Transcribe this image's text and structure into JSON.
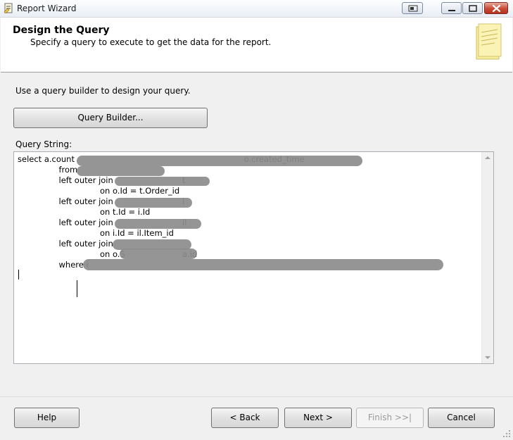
{
  "window": {
    "title": "Report Wizard",
    "icon": "report-wizard-icon"
  },
  "header": {
    "title": "Design the Query",
    "subtitle": "Specify a query to execute to get the data for the report.",
    "icon": "notepad-icon"
  },
  "body": {
    "instruction": "Use a query builder to design your query.",
    "query_builder_label": "Query Builder...",
    "query_string_label": "Query String:",
    "query_text": "select a.count\t\t\t\t\t\t\t\t\to.created_time\n\t\tfrom\n\t\tleft outer join\t\t\t\tt\n\t\t\t\ton o.Id = t.Order_id\n\t\tleft outer join\t\t\t\ti\n\t\t\t\ton t.Id = i.Id\n\t\tleft outer join\t\t\t\til\n\t\t\t\ton i.Id = il.Item_id\n\t\tleft outer join\n\t\t\t\ton o.S\t\t\ta.id\n\t\twhere i"
  },
  "footer": {
    "help_label": "Help",
    "back_label": "< Back",
    "next_label": "Next >",
    "finish_label": "Finish >>|",
    "cancel_label": "Cancel"
  },
  "colors": {
    "window_bg": "#f0f0f0",
    "header_bg": "#ffffff",
    "close_button": "#c94b36",
    "disabled_text": "#9a9a9a"
  }
}
